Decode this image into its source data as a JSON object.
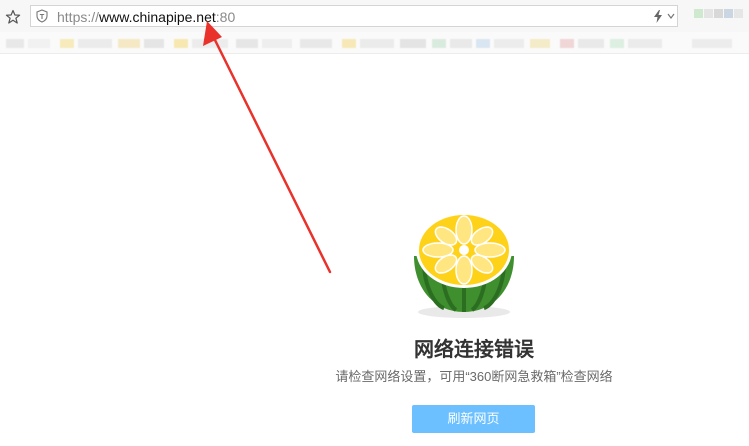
{
  "address_bar": {
    "url_scheme": "https://",
    "url_host": "www.chinapipe.net",
    "url_port": ":80"
  },
  "icons": {
    "bookmark": "star-icon",
    "security": "shield-icon",
    "speed": "lightning-icon",
    "dropdown": "chevron-down-icon",
    "logo": "melon-icon"
  },
  "error_page": {
    "title": "网络连接错误",
    "description": "请检查网络设置，可用“360断网急救箱”检查网络",
    "refresh_label": "刷新网页"
  },
  "colors": {
    "annotation_arrow": "#e8322b",
    "refresh_button": "#6cc0ff"
  }
}
